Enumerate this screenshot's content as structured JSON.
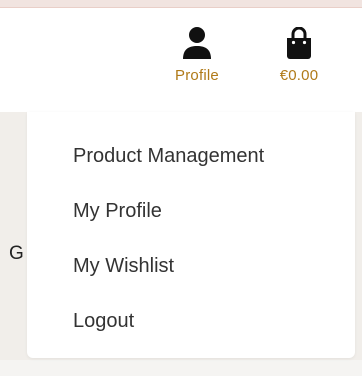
{
  "header": {
    "nav": [
      {
        "label": "Profile",
        "icon": "user-icon"
      },
      {
        "label": "€0.00",
        "icon": "shopping-bag-icon"
      }
    ],
    "accent_color": "#b07a18"
  },
  "behind_text": "G",
  "dropdown": {
    "items": [
      {
        "label": "Product Management"
      },
      {
        "label": "My Profile"
      },
      {
        "label": "My Wishlist"
      },
      {
        "label": "Logout"
      }
    ]
  }
}
